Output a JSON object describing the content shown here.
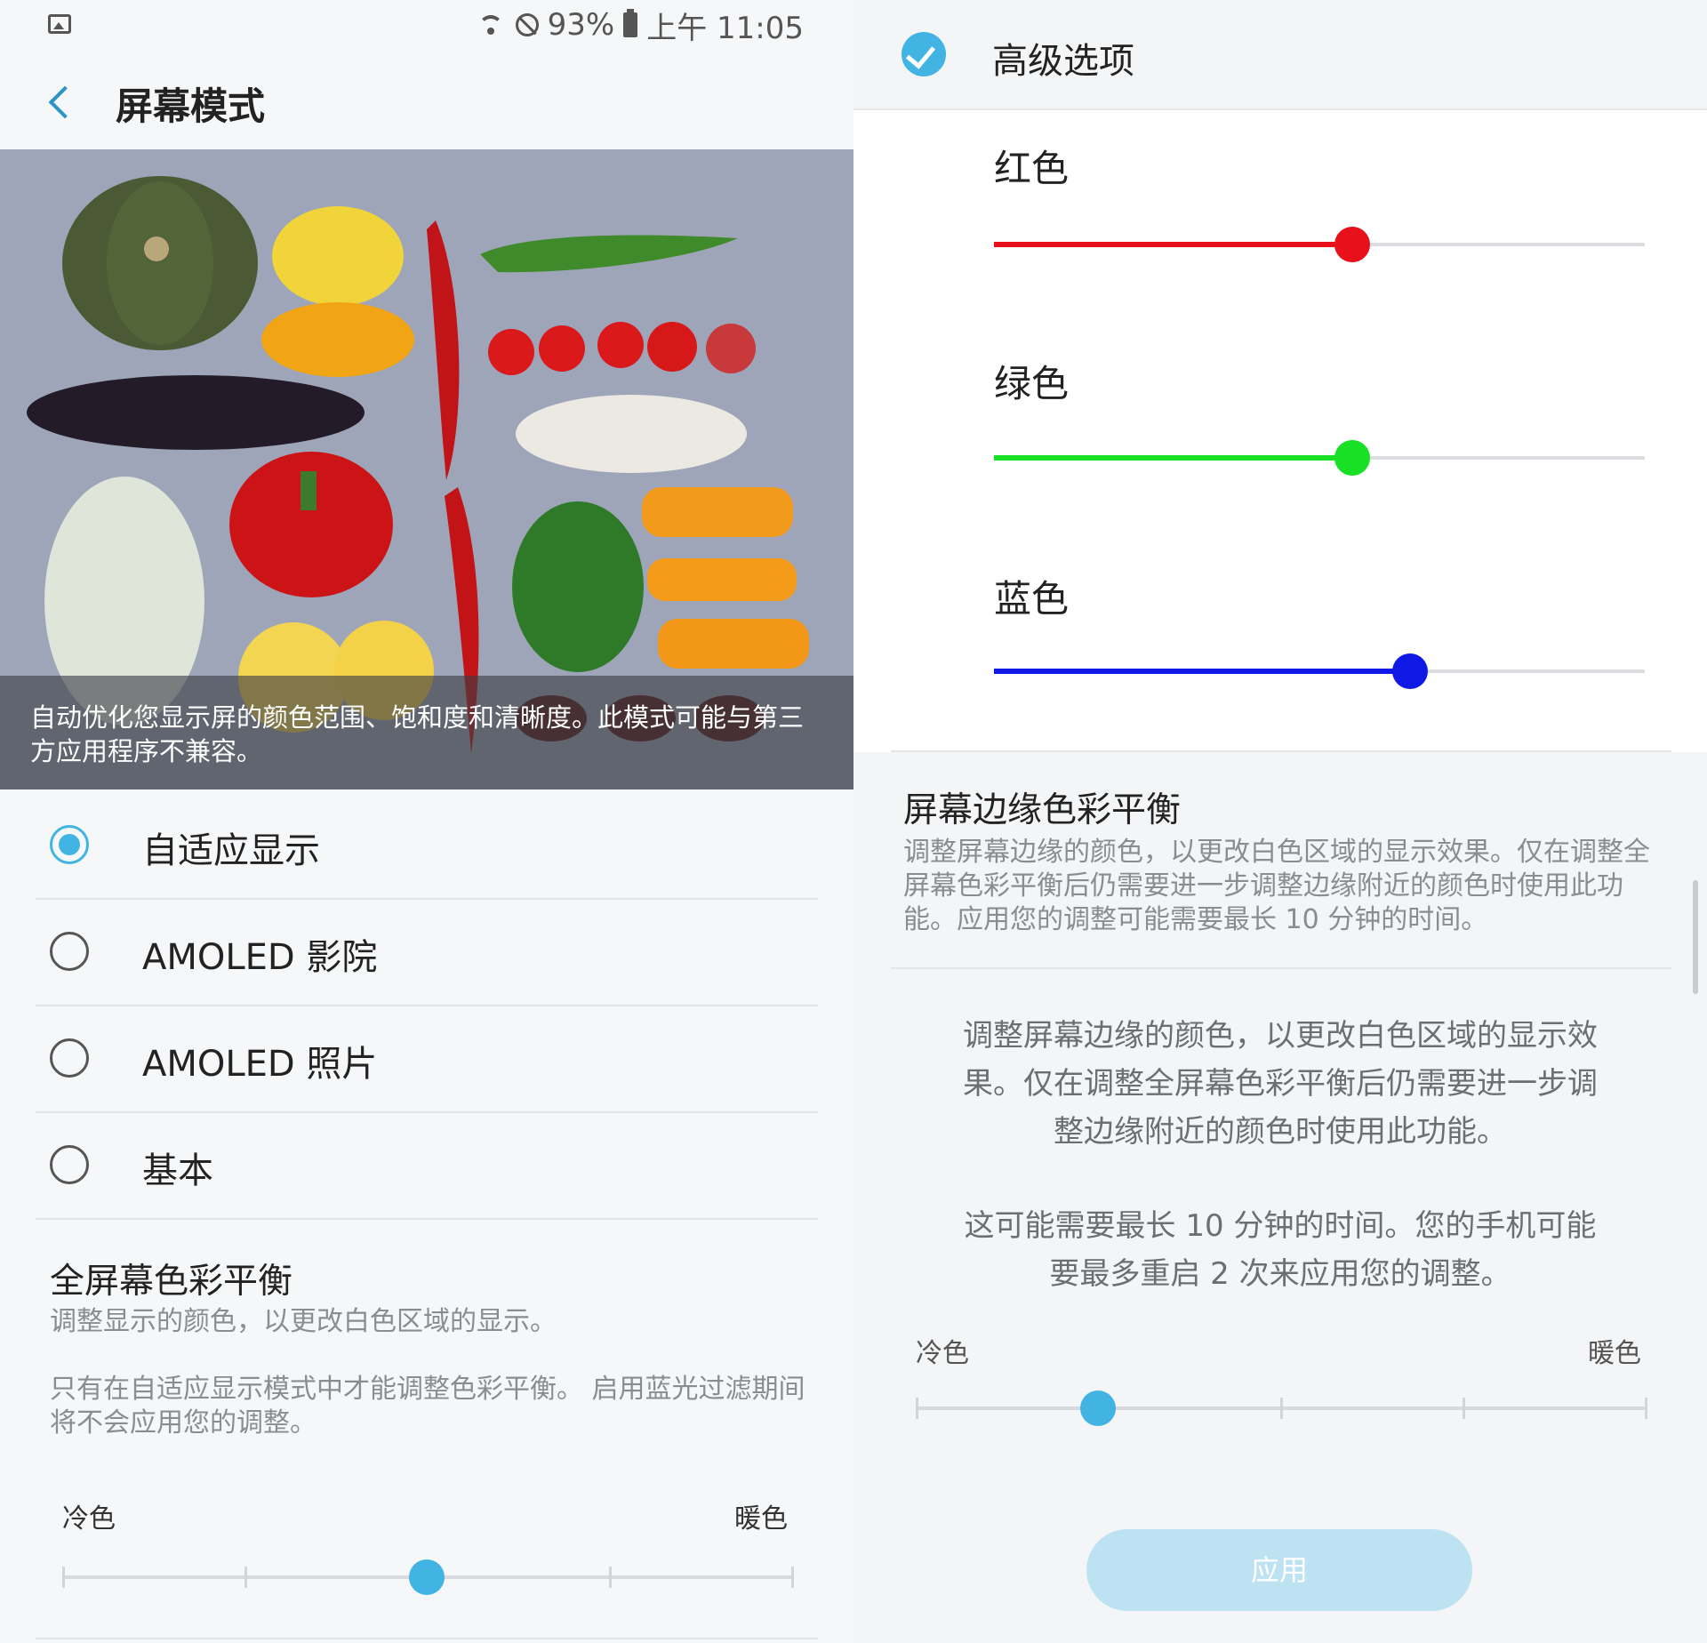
{
  "status_bar": {
    "battery": "93%",
    "time": "上午 11:05"
  },
  "screen_mode": {
    "title": "屏幕模式",
    "preview_caption": "自动优化您显示屏的颜色范围、饱和度和清晰度。此模式可能与第三方应用程序不兼容。",
    "modes": [
      {
        "label": "自适应显示",
        "selected": true
      },
      {
        "label": "AMOLED 影院",
        "selected": false
      },
      {
        "label": "AMOLED 照片",
        "selected": false
      },
      {
        "label": "基本",
        "selected": false
      }
    ],
    "full_balance": {
      "title": "全屏幕色彩平衡",
      "subtitle": "调整显示的颜色，以更改白色区域的显示。",
      "note": "只有在自适应显示模式中才能调整色彩平衡。 启用蓝光过滤期间将不会应用您的调整。",
      "cool_label": "冷色",
      "warm_label": "暖色",
      "steps": 5,
      "value_step": 3
    }
  },
  "advanced": {
    "title": "高级选项",
    "checked": true,
    "sliders": [
      {
        "label": "红色",
        "value": 0.55,
        "color": "#e8101a"
      },
      {
        "label": "绿色",
        "value": 0.55,
        "color": "#18e025"
      },
      {
        "label": "蓝色",
        "value": 0.64,
        "color": "#1018e6"
      }
    ],
    "edge_balance": {
      "title": "屏幕边缘色彩平衡",
      "description": "调整屏幕边缘的颜色，以更改白色区域的显示效果。仅在调整全屏幕色彩平衡后仍需要进一步调整边缘附近的颜色时使用此功能。应用您的调整可能需要最长 10 分钟的时间。"
    },
    "dialog": {
      "text1": "调整屏幕边缘的颜色，以更改白色区域的显示效果。仅在调整全屏幕色彩平衡后仍需要进一步调整边缘附近的颜色时使用此功能。",
      "text2": "这可能需要最长 10 分钟的时间。您的手机可能要最多重启 2 次来应用您的调整。",
      "cool_label": "冷色",
      "warm_label": "暖色",
      "steps": 5,
      "value_step": 2,
      "apply_label": "应用"
    }
  },
  "colors": {
    "accent": "#41b4e3",
    "apply_bg": "#bde3f3"
  }
}
